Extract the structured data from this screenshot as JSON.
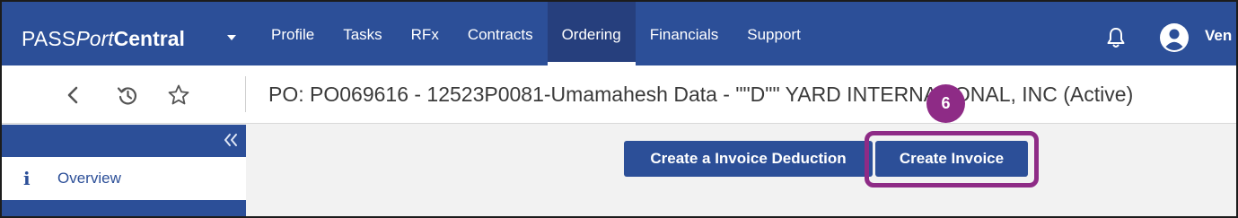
{
  "app": {
    "brand_prefix": "PASS",
    "brand_italic": "Port",
    "brand_bold": "Central",
    "user_name": "Ven"
  },
  "nav": {
    "items": [
      {
        "label": "Profile",
        "active": false
      },
      {
        "label": "Tasks",
        "active": false
      },
      {
        "label": "RFx",
        "active": false
      },
      {
        "label": "Contracts",
        "active": false
      },
      {
        "label": "Ordering",
        "active": true
      },
      {
        "label": "Financials",
        "active": false
      },
      {
        "label": "Support",
        "active": false
      }
    ]
  },
  "icons": {
    "brand_menu": "chevron-down-icon",
    "notifications": "bell-icon",
    "user": "user-avatar-icon",
    "back": "chevron-left-icon",
    "history": "history-icon",
    "favorite": "star-outline-icon",
    "collapse": "double-chevron-left-icon",
    "overview": "info-icon"
  },
  "header": {
    "title": "PO: PO069616 - 12523P0081-Umamahesh Data - \"\"D\"\" YARD INTERNATIONAL, INC (Active)"
  },
  "sidebar": {
    "overview_icon": "i",
    "overview_label": "Overview"
  },
  "actions": {
    "create_deduction_label": "Create a Invoice Deduction",
    "create_invoice_label": "Create Invoice"
  },
  "annotation": {
    "step_number": "6",
    "color": "#8e2b86"
  },
  "colors": {
    "brand_blue": "#2c4f98",
    "active_nav": "#263f7d",
    "annotation_purple": "#8e2b86"
  }
}
